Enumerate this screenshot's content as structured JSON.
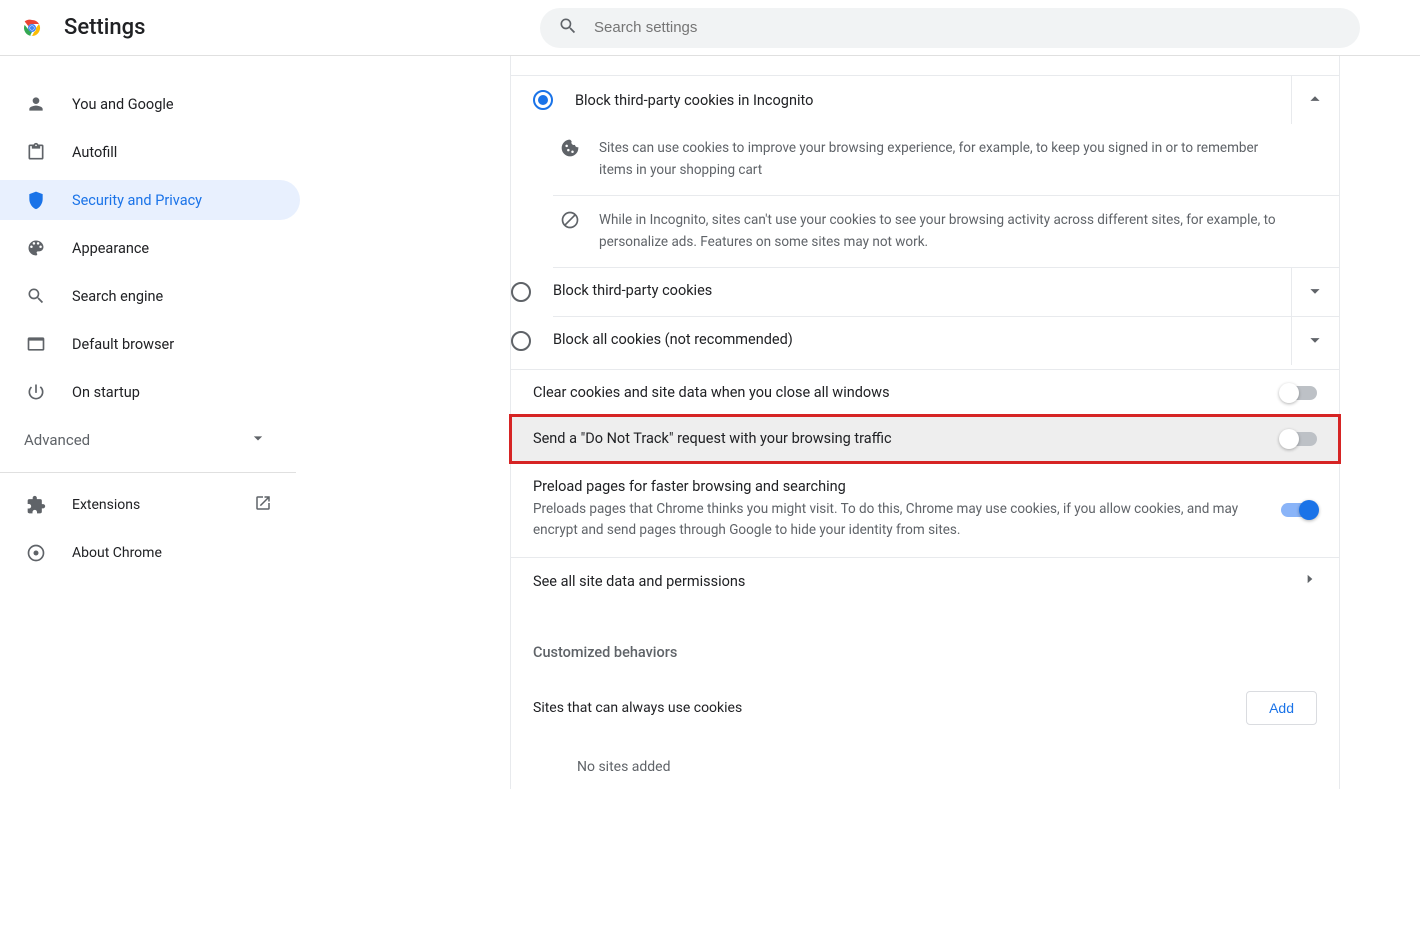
{
  "header": {
    "title": "Settings",
    "search_placeholder": "Search settings"
  },
  "sidebar": {
    "items": [
      {
        "label": "You and Google"
      },
      {
        "label": "Autofill"
      },
      {
        "label": "Security and Privacy"
      },
      {
        "label": "Appearance"
      },
      {
        "label": "Search engine"
      },
      {
        "label": "Default browser"
      },
      {
        "label": "On startup"
      }
    ],
    "advanced_label": "Advanced",
    "extensions_label": "Extensions",
    "about_label": "About Chrome"
  },
  "cookies": {
    "opt_incognito": "Block third-party cookies in Incognito",
    "incognito_desc1": "Sites can use cookies to improve your browsing experience, for example, to keep you signed in or to remember items in your shopping cart",
    "incognito_desc2": "While in Incognito, sites can't use your cookies to see your browsing activity across different sites, for example, to personalize ads. Features on some sites may not work.",
    "opt_third": "Block third-party cookies",
    "opt_all": "Block all cookies (not recommended)"
  },
  "toggles": {
    "clear_on_close": "Clear cookies and site data when you close all windows",
    "dnt": "Send a \"Do Not Track\" request with your browsing traffic"
  },
  "preload": {
    "title": "Preload pages for faster browsing and searching",
    "desc": "Preloads pages that Chrome thinks you might visit. To do this, Chrome may use cookies, if you allow cookies, and may encrypt and send pages through Google to hide your identity from sites."
  },
  "links": {
    "see_all": "See all site data and permissions"
  },
  "custom": {
    "heading": "Customized behaviors",
    "sites_always": "Sites that can always use cookies",
    "add": "Add",
    "no_sites": "No sites added"
  }
}
